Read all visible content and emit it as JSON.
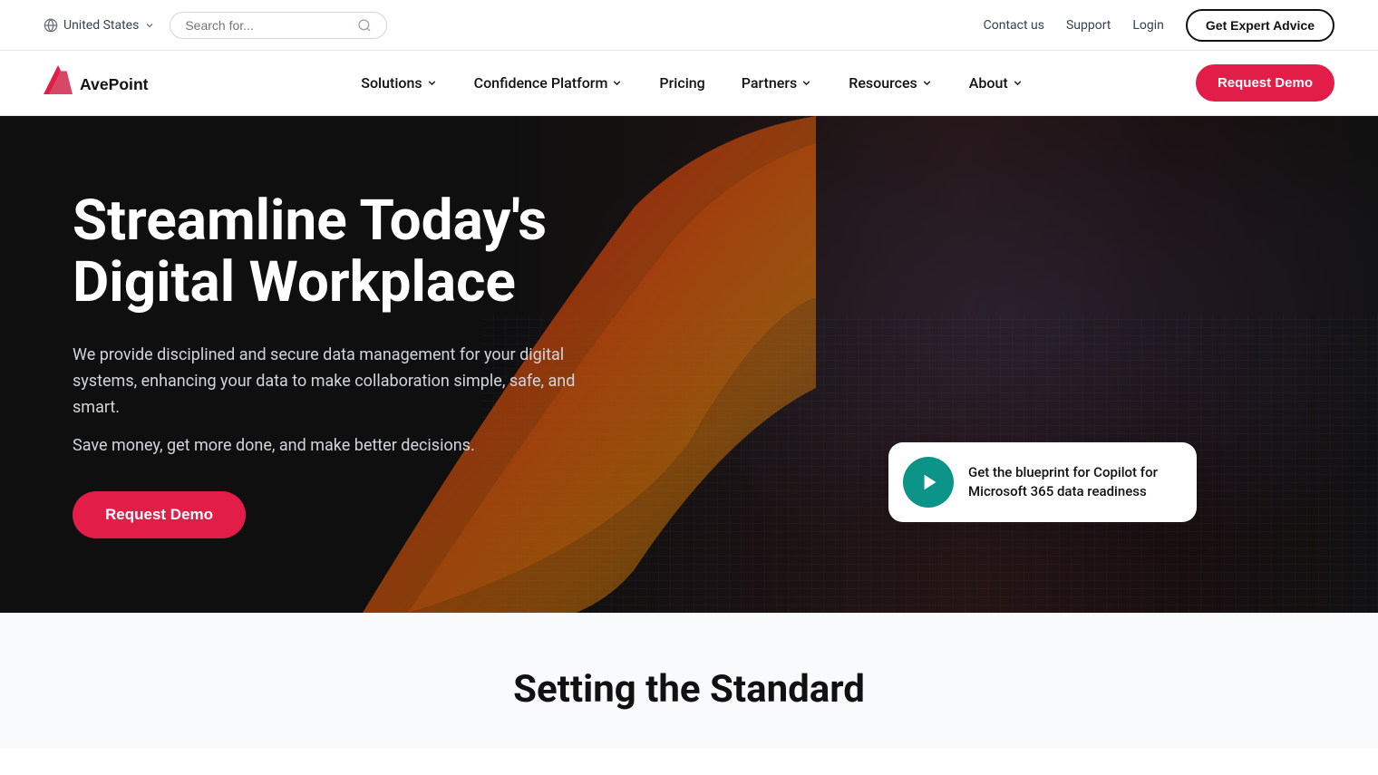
{
  "topbar": {
    "region": "United States",
    "search_placeholder": "Search for...",
    "links": [
      {
        "label": "Contact us",
        "name": "contact-us-link"
      },
      {
        "label": "Support",
        "name": "support-link"
      },
      {
        "label": "Login",
        "name": "login-link"
      }
    ],
    "expert_btn": "Get Expert Advice"
  },
  "nav": {
    "logo_alt": "AvePoint",
    "logo_text": "AvePoint",
    "items": [
      {
        "label": "Solutions",
        "has_dropdown": true,
        "name": "nav-solutions"
      },
      {
        "label": "Confidence Platform",
        "has_dropdown": true,
        "name": "nav-confidence-platform"
      },
      {
        "label": "Pricing",
        "has_dropdown": false,
        "name": "nav-pricing"
      },
      {
        "label": "Partners",
        "has_dropdown": true,
        "name": "nav-partners"
      },
      {
        "label": "Resources",
        "has_dropdown": true,
        "name": "nav-resources"
      },
      {
        "label": "About",
        "has_dropdown": true,
        "name": "nav-about"
      }
    ],
    "request_demo_btn": "Request Demo"
  },
  "hero": {
    "title_line1": "Streamline Today's",
    "title_line2": "Digital Workplace",
    "subtitle": "We provide disciplined and secure data management for your digital systems, enhancing your data to make collaboration simple, safe, and smart.",
    "sub2": "Save money, get more done, and make better decisions.",
    "cta_label": "Request Demo",
    "video_card": {
      "text": "Get the blueprint for Copilot for Microsoft 365 data readiness",
      "play_label": "Play video"
    }
  },
  "below_fold": {
    "title": "Setting the Standard"
  },
  "colors": {
    "brand_red": "#e11d48",
    "teal": "#0d9488"
  }
}
